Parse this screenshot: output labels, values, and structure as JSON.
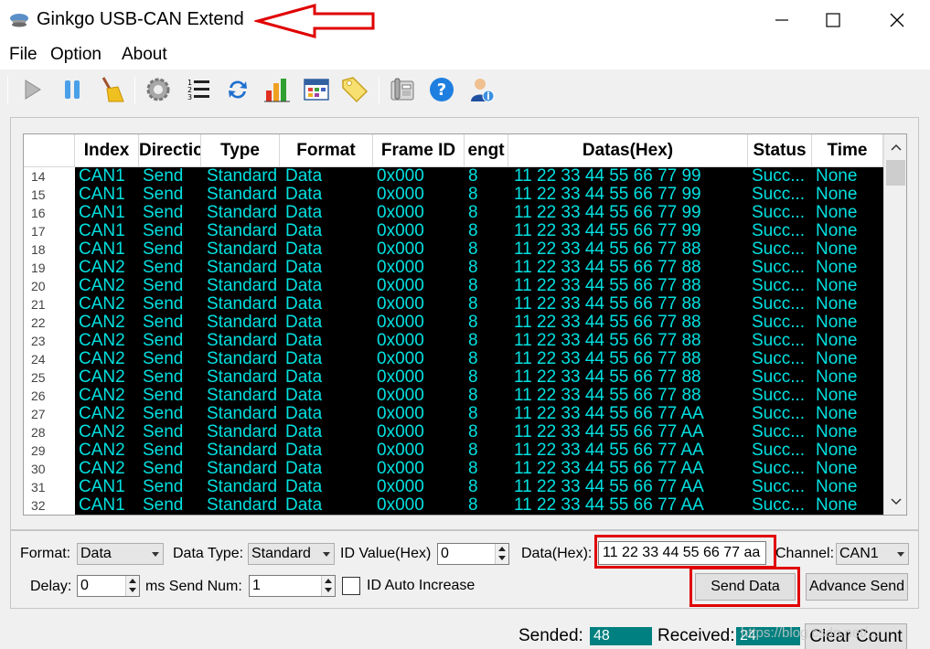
{
  "window": {
    "title": "Ginkgo USB-CAN Extend",
    "min_glyph": "—",
    "max_glyph": "☐",
    "close_glyph": "✕"
  },
  "menu": [
    "File",
    "Option",
    "About"
  ],
  "toolbar": [
    "start-icon",
    "pause-icon",
    "clear-icon",
    "settings-icon",
    "list-icon",
    "refresh-icon",
    "chart-icon",
    "calendar-icon",
    "tag-icon",
    "phone-icon",
    "help-icon",
    "user-info-icon"
  ],
  "grid": {
    "headers": [
      "Index",
      "Directio",
      "Type",
      "Format",
      "Frame ID",
      "engt",
      "Datas(Hex)",
      "Status",
      "Time"
    ],
    "rows": [
      {
        "n": "14",
        "ch": "CAN1",
        "dir": "Send",
        "type": "Standard",
        "fmt": "Data",
        "id": "0x000",
        "len": "8",
        "data": "11 22 33 44 55 66 77 99",
        "status": "Succ...",
        "time": "None"
      },
      {
        "n": "15",
        "ch": "CAN1",
        "dir": "Send",
        "type": "Standard",
        "fmt": "Data",
        "id": "0x000",
        "len": "8",
        "data": "11 22 33 44 55 66 77 99",
        "status": "Succ...",
        "time": "None"
      },
      {
        "n": "16",
        "ch": "CAN1",
        "dir": "Send",
        "type": "Standard",
        "fmt": "Data",
        "id": "0x000",
        "len": "8",
        "data": "11 22 33 44 55 66 77 99",
        "status": "Succ...",
        "time": "None"
      },
      {
        "n": "17",
        "ch": "CAN1",
        "dir": "Send",
        "type": "Standard",
        "fmt": "Data",
        "id": "0x000",
        "len": "8",
        "data": "11 22 33 44 55 66 77 99",
        "status": "Succ...",
        "time": "None"
      },
      {
        "n": "18",
        "ch": "CAN1",
        "dir": "Send",
        "type": "Standard",
        "fmt": "Data",
        "id": "0x000",
        "len": "8",
        "data": "11 22 33 44 55 66 77 88",
        "status": "Succ...",
        "time": "None"
      },
      {
        "n": "19",
        "ch": "CAN2",
        "dir": "Send",
        "type": "Standard",
        "fmt": "Data",
        "id": "0x000",
        "len": "8",
        "data": "11 22 33 44 55 66 77 88",
        "status": "Succ...",
        "time": "None"
      },
      {
        "n": "20",
        "ch": "CAN2",
        "dir": "Send",
        "type": "Standard",
        "fmt": "Data",
        "id": "0x000",
        "len": "8",
        "data": "11 22 33 44 55 66 77 88",
        "status": "Succ...",
        "time": "None"
      },
      {
        "n": "21",
        "ch": "CAN2",
        "dir": "Send",
        "type": "Standard",
        "fmt": "Data",
        "id": "0x000",
        "len": "8",
        "data": "11 22 33 44 55 66 77 88",
        "status": "Succ...",
        "time": "None"
      },
      {
        "n": "22",
        "ch": "CAN2",
        "dir": "Send",
        "type": "Standard",
        "fmt": "Data",
        "id": "0x000",
        "len": "8",
        "data": "11 22 33 44 55 66 77 88",
        "status": "Succ...",
        "time": "None"
      },
      {
        "n": "23",
        "ch": "CAN2",
        "dir": "Send",
        "type": "Standard",
        "fmt": "Data",
        "id": "0x000",
        "len": "8",
        "data": "11 22 33 44 55 66 77 88",
        "status": "Succ...",
        "time": "None"
      },
      {
        "n": "24",
        "ch": "CAN2",
        "dir": "Send",
        "type": "Standard",
        "fmt": "Data",
        "id": "0x000",
        "len": "8",
        "data": "11 22 33 44 55 66 77 88",
        "status": "Succ...",
        "time": "None"
      },
      {
        "n": "25",
        "ch": "CAN2",
        "dir": "Send",
        "type": "Standard",
        "fmt": "Data",
        "id": "0x000",
        "len": "8",
        "data": "11 22 33 44 55 66 77 88",
        "status": "Succ...",
        "time": "None"
      },
      {
        "n": "26",
        "ch": "CAN2",
        "dir": "Send",
        "type": "Standard",
        "fmt": "Data",
        "id": "0x000",
        "len": "8",
        "data": "11 22 33 44 55 66 77 88",
        "status": "Succ...",
        "time": "None"
      },
      {
        "n": "27",
        "ch": "CAN2",
        "dir": "Send",
        "type": "Standard",
        "fmt": "Data",
        "id": "0x000",
        "len": "8",
        "data": "11 22 33 44 55 66 77 AA",
        "status": "Succ...",
        "time": "None"
      },
      {
        "n": "28",
        "ch": "CAN2",
        "dir": "Send",
        "type": "Standard",
        "fmt": "Data",
        "id": "0x000",
        "len": "8",
        "data": "11 22 33 44 55 66 77 AA",
        "status": "Succ...",
        "time": "None"
      },
      {
        "n": "29",
        "ch": "CAN2",
        "dir": "Send",
        "type": "Standard",
        "fmt": "Data",
        "id": "0x000",
        "len": "8",
        "data": "11 22 33 44 55 66 77 AA",
        "status": "Succ...",
        "time": "None"
      },
      {
        "n": "30",
        "ch": "CAN2",
        "dir": "Send",
        "type": "Standard",
        "fmt": "Data",
        "id": "0x000",
        "len": "8",
        "data": "11 22 33 44 55 66 77 AA",
        "status": "Succ...",
        "time": "None"
      },
      {
        "n": "31",
        "ch": "CAN1",
        "dir": "Send",
        "type": "Standard",
        "fmt": "Data",
        "id": "0x000",
        "len": "8",
        "data": "11 22 33 44 55 66 77 AA",
        "status": "Succ...",
        "time": "None"
      },
      {
        "n": "32",
        "ch": "CAN1",
        "dir": "Send",
        "type": "Standard",
        "fmt": "Data",
        "id": "0x000",
        "len": "8",
        "data": "11 22 33 44 55 66 77 AA",
        "status": "Succ...",
        "time": "None"
      }
    ]
  },
  "controls": {
    "format_label": "Format:",
    "format_value": "Data",
    "data_type_label": "Data Type:",
    "data_type_value": "Standard",
    "id_label": "ID Value(Hex)",
    "id_value": "0",
    "data_hex_label": "Data(Hex):",
    "data_hex_value": "11 22 33 44 55 66 77 aa",
    "channel_label": "Channel:",
    "channel_value": "CAN1",
    "delay_label": "Delay:",
    "delay_value": "0",
    "ms_send_num_label": "ms Send Num:",
    "send_num_value": "1",
    "id_auto_increase_label": "ID Auto Increase",
    "send_data_button": "Send Data",
    "advance_send_button": "Advance Send"
  },
  "status": {
    "sended_label": "Sended:",
    "sended_value": "48",
    "received_label": "Received:",
    "received_value": "24",
    "clear_count_button": "Clear Count",
    "watermark": "https://blog.csdn.net/..."
  },
  "colors": {
    "data_text": "#00e0e0",
    "data_bg": "#000000",
    "status_box": "#008080",
    "highlight": "#e00000"
  }
}
